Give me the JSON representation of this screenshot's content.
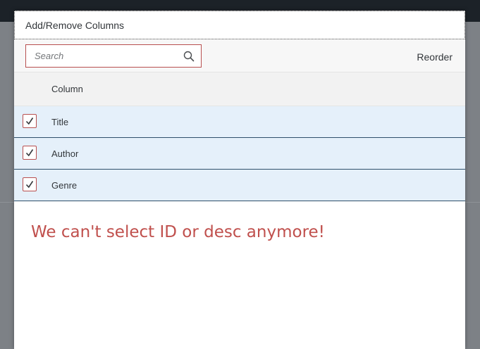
{
  "dialog": {
    "title": "Add/Remove Columns"
  },
  "toolbar": {
    "search_placeholder": "Search",
    "search_value": "",
    "reorder_label": "Reorder"
  },
  "table": {
    "header": "Column",
    "rows": [
      {
        "label": "Title",
        "checked": true
      },
      {
        "label": "Author",
        "checked": true
      },
      {
        "label": "Genre",
        "checked": true
      }
    ]
  },
  "annotation": {
    "text": "We can't select ID or desc anymore!"
  },
  "colors": {
    "accent": "#b84f4f",
    "selected_row_bg": "#e5f0fa",
    "annotation": "#c0504d",
    "topbar": "#1c2228"
  },
  "icons": {
    "search": "search-icon",
    "checkbox": "checkmark-icon"
  }
}
